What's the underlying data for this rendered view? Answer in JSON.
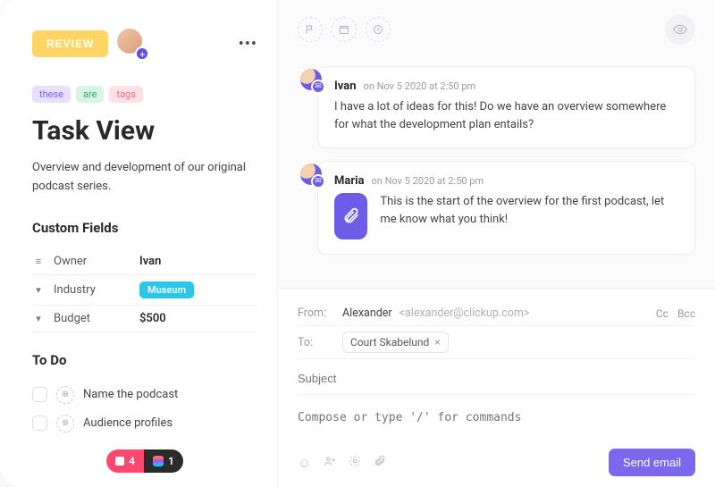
{
  "header": {
    "status_label": "REVIEW"
  },
  "tags": [
    "these",
    "are",
    "tags"
  ],
  "title": "Task View",
  "description": "Overview and development of our original podcast series.",
  "custom_fields": {
    "heading": "Custom Fields",
    "owner_label": "Owner",
    "owner_value": "Ivan",
    "industry_label": "Industry",
    "industry_value": "Museum",
    "budget_label": "Budget",
    "budget_value": "$500"
  },
  "todo": {
    "heading": "To Do",
    "items": [
      "Name the podcast",
      "Audience profiles"
    ]
  },
  "footer": {
    "red_count": "4",
    "dark_count": "1"
  },
  "comments": [
    {
      "author": "Ivan",
      "time": "on Nov 5 2020 at 2:50 pm",
      "body": "I have a lot of ideas for this! Do we have an overview somewhere for what the development plan entails?"
    },
    {
      "author": "Maria",
      "time": "on Nov 5 2020 at 2:50 pm",
      "body": "This is the start of the overview for the first podcast, let me know what you think!"
    }
  ],
  "compose": {
    "from_label": "From:",
    "from_name": "Alexander",
    "from_email": "<alexander@clickup.com>",
    "cc": "Cc",
    "bcc": "Bcc",
    "to_label": "To:",
    "to_chip": "Court Skabelund",
    "subject_placeholder": "Subject",
    "body_placeholder": "Compose or type '/' for commands",
    "send_label": "Send email"
  }
}
